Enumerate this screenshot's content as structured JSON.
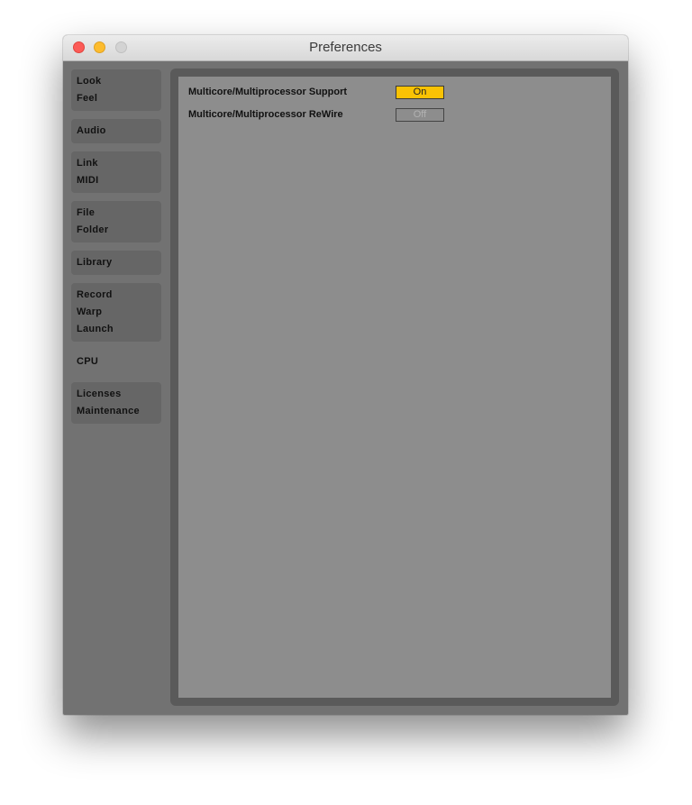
{
  "window": {
    "title": "Preferences",
    "controls": [
      "close",
      "minimize",
      "maximize"
    ]
  },
  "sidebar": {
    "groups": [
      {
        "items": [
          "Look",
          "Feel"
        ]
      },
      {
        "items": [
          "Audio"
        ]
      },
      {
        "items": [
          "Link",
          "MIDI"
        ]
      },
      {
        "items": [
          "File",
          "Folder"
        ]
      },
      {
        "items": [
          "Library"
        ]
      },
      {
        "items": [
          "Record",
          "Warp",
          "Launch"
        ]
      },
      {
        "items": [
          "CPU"
        ],
        "active": true
      },
      {
        "items": [
          "Licenses",
          "Maintenance"
        ]
      }
    ]
  },
  "cpu": {
    "settings": [
      {
        "label": "Multicore/Multiprocessor Support",
        "value": "On",
        "state": "on"
      },
      {
        "label": "Multicore/Multiprocessor ReWire",
        "value": "Off",
        "state": "off"
      }
    ]
  },
  "colors": {
    "toggle_on": "#f9c204",
    "panel_bg": "#8d8d8d",
    "sidebar_bg": "#727272"
  }
}
